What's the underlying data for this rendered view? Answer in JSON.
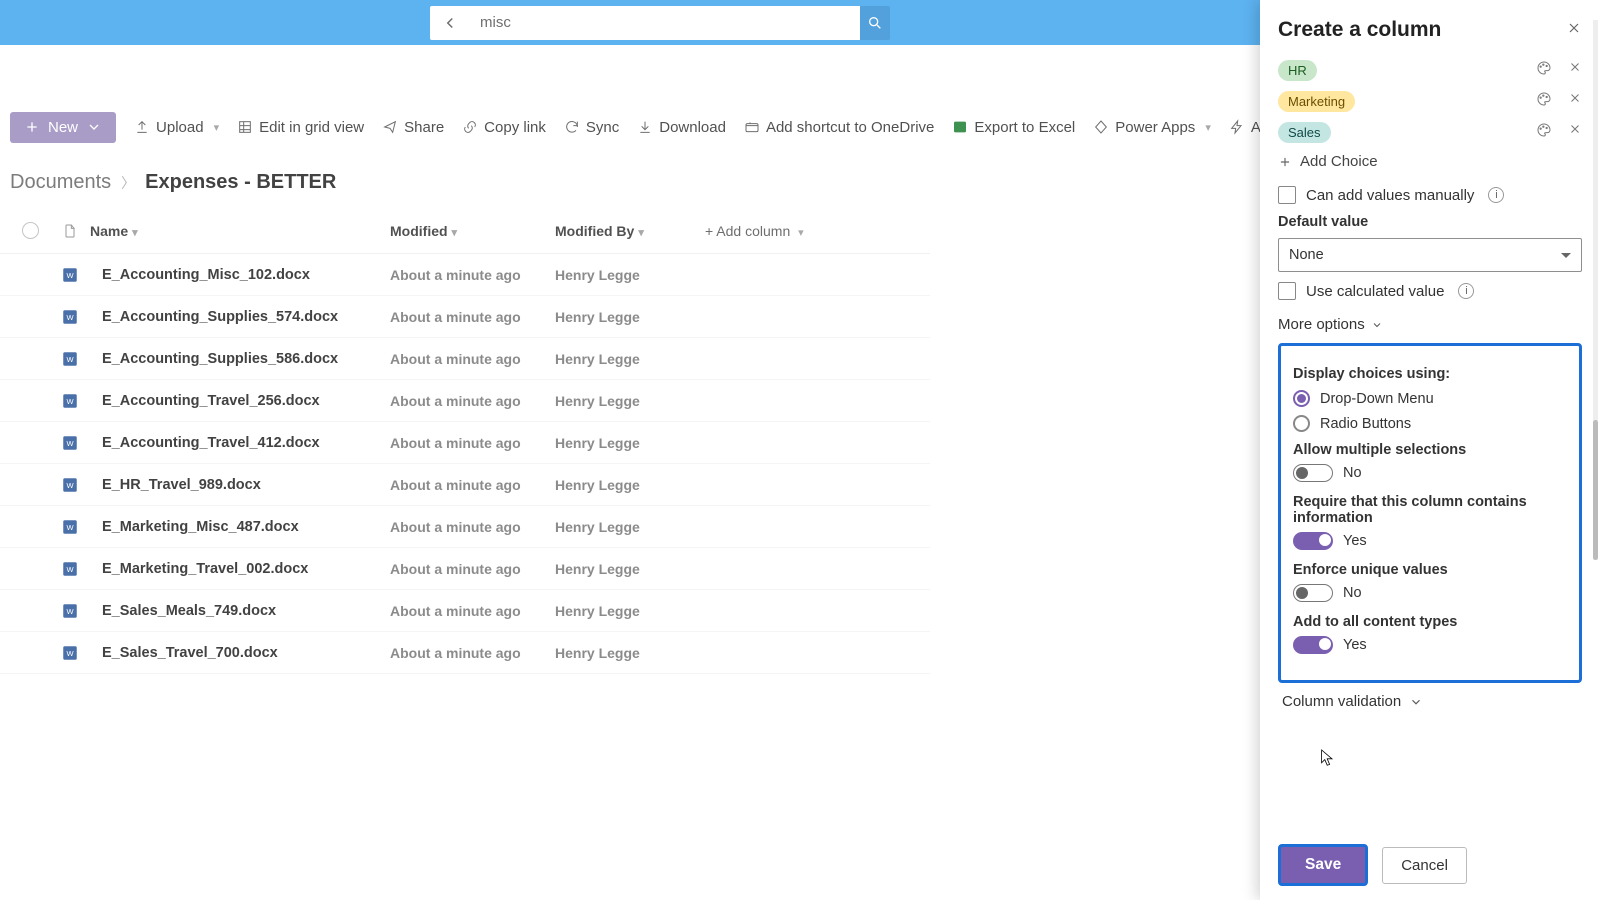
{
  "search": {
    "value": "misc"
  },
  "commandbar": {
    "new": "New",
    "upload": "Upload",
    "editgrid": "Edit in grid view",
    "share": "Share",
    "copylink": "Copy link",
    "sync": "Sync",
    "download": "Download",
    "shortcut": "Add shortcut to OneDrive",
    "export": "Export to Excel",
    "powerapps": "Power Apps",
    "automate": "Automate"
  },
  "breadcrumb": {
    "library": "Documents",
    "current": "Expenses - BETTER"
  },
  "columns": {
    "name": "Name",
    "modified": "Modified",
    "modifiedBy": "Modified By",
    "add": "Add column"
  },
  "rows": [
    {
      "name": "E_Accounting_Misc_102.docx",
      "modified": "About a minute ago",
      "by": "Henry Legge"
    },
    {
      "name": "E_Accounting_Supplies_574.docx",
      "modified": "About a minute ago",
      "by": "Henry Legge"
    },
    {
      "name": "E_Accounting_Supplies_586.docx",
      "modified": "About a minute ago",
      "by": "Henry Legge"
    },
    {
      "name": "E_Accounting_Travel_256.docx",
      "modified": "About a minute ago",
      "by": "Henry Legge"
    },
    {
      "name": "E_Accounting_Travel_412.docx",
      "modified": "About a minute ago",
      "by": "Henry Legge"
    },
    {
      "name": "E_HR_Travel_989.docx",
      "modified": "About a minute ago",
      "by": "Henry Legge"
    },
    {
      "name": "E_Marketing_Misc_487.docx",
      "modified": "About a minute ago",
      "by": "Henry Legge"
    },
    {
      "name": "E_Marketing_Travel_002.docx",
      "modified": "About a minute ago",
      "by": "Henry Legge"
    },
    {
      "name": "E_Sales_Meals_749.docx",
      "modified": "About a minute ago",
      "by": "Henry Legge"
    },
    {
      "name": "E_Sales_Travel_700.docx",
      "modified": "About a minute ago",
      "by": "Henry Legge"
    }
  ],
  "panel": {
    "title": "Create a column",
    "choices": [
      {
        "label": "HR",
        "cls": "pill-hr"
      },
      {
        "label": "Marketing",
        "cls": "pill-mkt"
      },
      {
        "label": "Sales",
        "cls": "pill-sales"
      }
    ],
    "addChoice": "Add Choice",
    "canAddManual": "Can add values manually",
    "defaultValueLabel": "Default value",
    "defaultValue": "None",
    "useCalc": "Use calculated value",
    "moreOptions": "More options",
    "displayUsing": "Display choices using:",
    "dropDown": "Drop-Down Menu",
    "radioButtons": "Radio Buttons",
    "allowMulti": "Allow multiple selections",
    "allowMultiVal": "No",
    "requireInfo": "Require that this column contains information",
    "requireInfoVal": "Yes",
    "enforceUnique": "Enforce unique values",
    "enforceUniqueVal": "No",
    "addAllTypes": "Add to all content types",
    "addAllTypesVal": "Yes",
    "columnValidation": "Column validation",
    "save": "Save",
    "cancel": "Cancel"
  }
}
